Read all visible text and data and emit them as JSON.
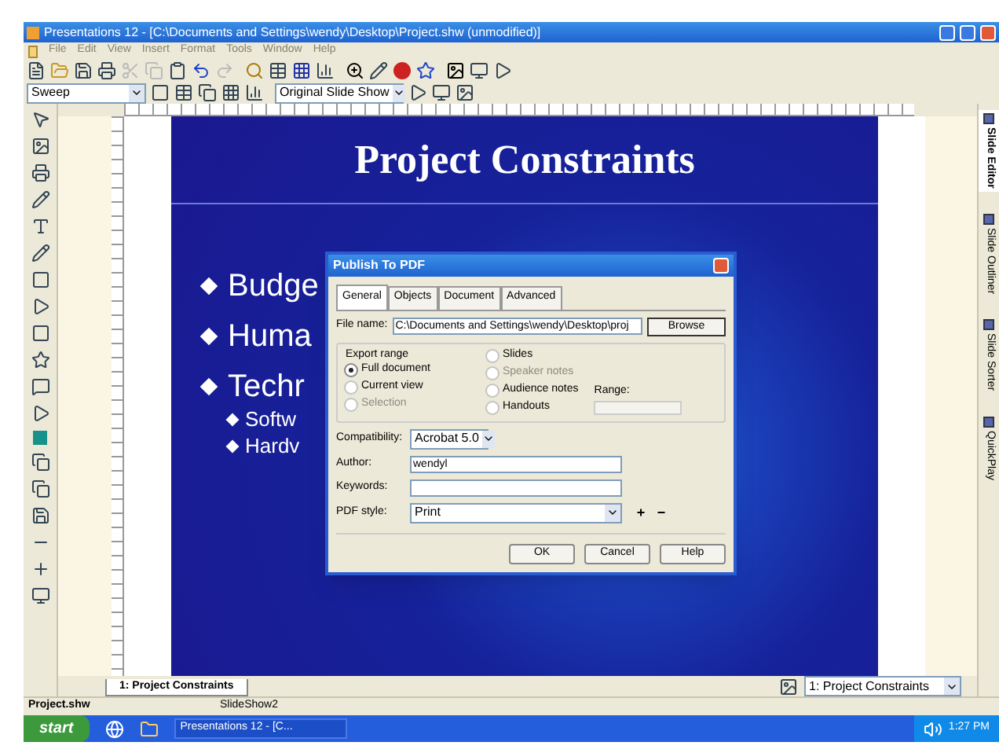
{
  "window": {
    "title": "Presentations 12 - [C:\\Documents and Settings\\wendy\\Desktop\\Project.shw (unmodified)]"
  },
  "menu": [
    {
      "label": "File",
      "disabled": true
    },
    {
      "label": "Edit",
      "disabled": true
    },
    {
      "label": "View",
      "disabled": true
    },
    {
      "label": "Insert",
      "disabled": true
    },
    {
      "label": "Format",
      "disabled": true
    },
    {
      "label": "Tools",
      "disabled": true
    },
    {
      "label": "Window",
      "disabled": true
    },
    {
      "label": "Help",
      "disabled": true
    }
  ],
  "toolbar": {
    "master": "Sweep",
    "slideshow": "Original Slide Show"
  },
  "side_tabs": [
    {
      "label": "Slide Editor",
      "selected": true
    },
    {
      "label": "Slide Outliner",
      "selected": false
    },
    {
      "label": "Slide Sorter",
      "selected": false
    },
    {
      "label": "QuickPlay",
      "selected": false
    }
  ],
  "slide": {
    "title": "Project Constraints",
    "bullets": [
      {
        "text": "Budge"
      },
      {
        "text": "Huma"
      },
      {
        "text": "Techr",
        "children": [
          {
            "text": "Softw"
          },
          {
            "text": "Hardv"
          }
        ]
      }
    ]
  },
  "dialog": {
    "title": "Publish To PDF",
    "tabs": [
      {
        "label": "General",
        "selected": true
      },
      {
        "label": "Objects",
        "selected": false
      },
      {
        "label": "Document",
        "selected": false
      },
      {
        "label": "Advanced",
        "selected": false
      }
    ],
    "file_name": {
      "label": "File name:",
      "value": "C:\\Documents and Settings\\wendy\\Desktop\\proj"
    },
    "browse": "Browse",
    "export_range": {
      "label": "Export range",
      "options": [
        {
          "label": "Full document",
          "selected": true,
          "disabled": false
        },
        {
          "label": "Current view",
          "selected": false,
          "disabled": false
        },
        {
          "label": "Selection",
          "selected": false,
          "disabled": true
        },
        {
          "label": "Slides",
          "selected": false,
          "disabled": false
        },
        {
          "label": "Speaker notes",
          "selected": false,
          "disabled": true
        },
        {
          "label": "Audience notes",
          "selected": false,
          "disabled": false
        },
        {
          "label": "Handouts",
          "selected": false,
          "disabled": false
        }
      ],
      "range_label": "Range:"
    },
    "compatibility": {
      "label": "Compatibility:",
      "value": "Acrobat 5.0"
    },
    "author": {
      "label": "Author:",
      "value": "wendyl"
    },
    "keywords": {
      "label": "Keywords:"
    },
    "pdf_style": {
      "label": "PDF style:",
      "value": "Print",
      "add": "+",
      "remove": "−"
    },
    "buttons": [
      "OK",
      "Cancel",
      "Help"
    ]
  },
  "slide_tab": "1: Project Constraints",
  "slide_select": "1: Project Constraints",
  "status_bar": [
    "Project.shw",
    "SlideShow2"
  ],
  "taskbar": {
    "start": "start",
    "task": "Presentations 12 - [C...",
    "clock": "1:27 PM"
  }
}
